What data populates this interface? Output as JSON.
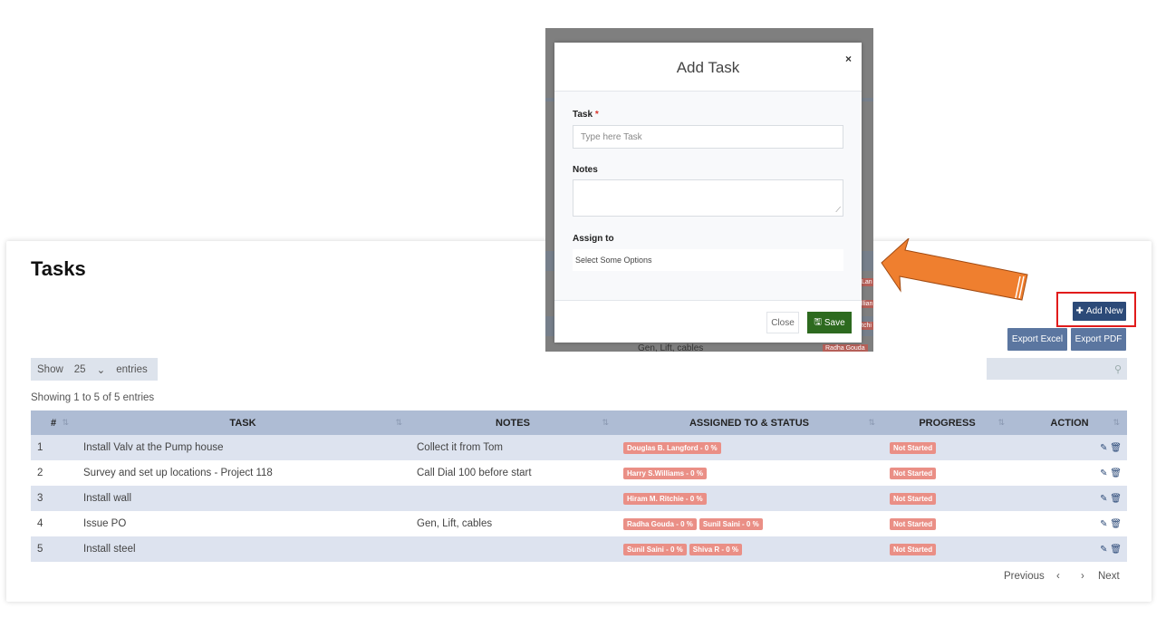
{
  "page": {
    "title": "Tasks",
    "add_new": "Add New",
    "export_excel": "Export Excel",
    "export_pdf": "Export PDF",
    "show_label": "Show",
    "entries_count": "25",
    "entries_label": "entries",
    "info": "Showing 1 to 5 of 5 entries",
    "prev": "Previous",
    "next": "Next",
    "prev_glyph": "‹",
    "next_glyph": "›"
  },
  "icons": {
    "plus": "plus-icon",
    "save": "floppy-disk-icon",
    "edit": "pencil-icon",
    "delete": "trash-icon",
    "search": "search-icon",
    "sort": "sort-icon",
    "chevron": "chevron-down-icon"
  },
  "colors": {
    "accent": "#2c4a78",
    "badge": "#ea8f86",
    "save": "#2d6a1f",
    "highlight": "#e11b1b",
    "arrow": "#ef7f2f"
  },
  "table": {
    "headers": [
      "#",
      "TASK",
      "NOTES",
      "ASSIGNED TO & STATUS",
      "PROGRESS",
      "ACTION"
    ],
    "rows": [
      {
        "num": "1",
        "task": "Install Valv at the Pump house",
        "notes": "Collect it from Tom",
        "assigned": [
          "Douglas B. Langford - 0 %"
        ],
        "progress": "Not Started"
      },
      {
        "num": "2",
        "task": "Survey and set up locations - Project 118",
        "notes": "Call Dial 100 before start",
        "assigned": [
          "Harry S.Williams - 0 %"
        ],
        "progress": "Not Started"
      },
      {
        "num": "3",
        "task": "Install wall",
        "notes": "",
        "assigned": [
          "Hiram M. Ritchie - 0 %"
        ],
        "progress": "Not Started"
      },
      {
        "num": "4",
        "task": "Issue PO",
        "notes": "Gen, Lift, cables",
        "assigned": [
          "Radha Gouda - 0 %",
          "Sunil Saini - 0 %"
        ],
        "progress": "Not Started"
      },
      {
        "num": "5",
        "task": "Install steel",
        "notes": "",
        "assigned": [
          "Sunil Saini - 0 %",
          "Shiva R - 0 %"
        ],
        "progress": "Not Started"
      }
    ]
  },
  "modal": {
    "title": "Add Task",
    "close_x": "×",
    "task_label": "Task",
    "required_mark": "*",
    "task_placeholder": "Type here Task",
    "notes_label": "Notes",
    "assign_label": "Assign to",
    "assign_placeholder": "Select Some Options",
    "close_btn": "Close",
    "save_btn": "Save"
  },
  "overlay_bg": {
    "notes_text": "Gen, Lift, cables",
    "badges": [
      "Lan",
      "llian",
      "tchi",
      "Radha Gouda"
    ]
  }
}
